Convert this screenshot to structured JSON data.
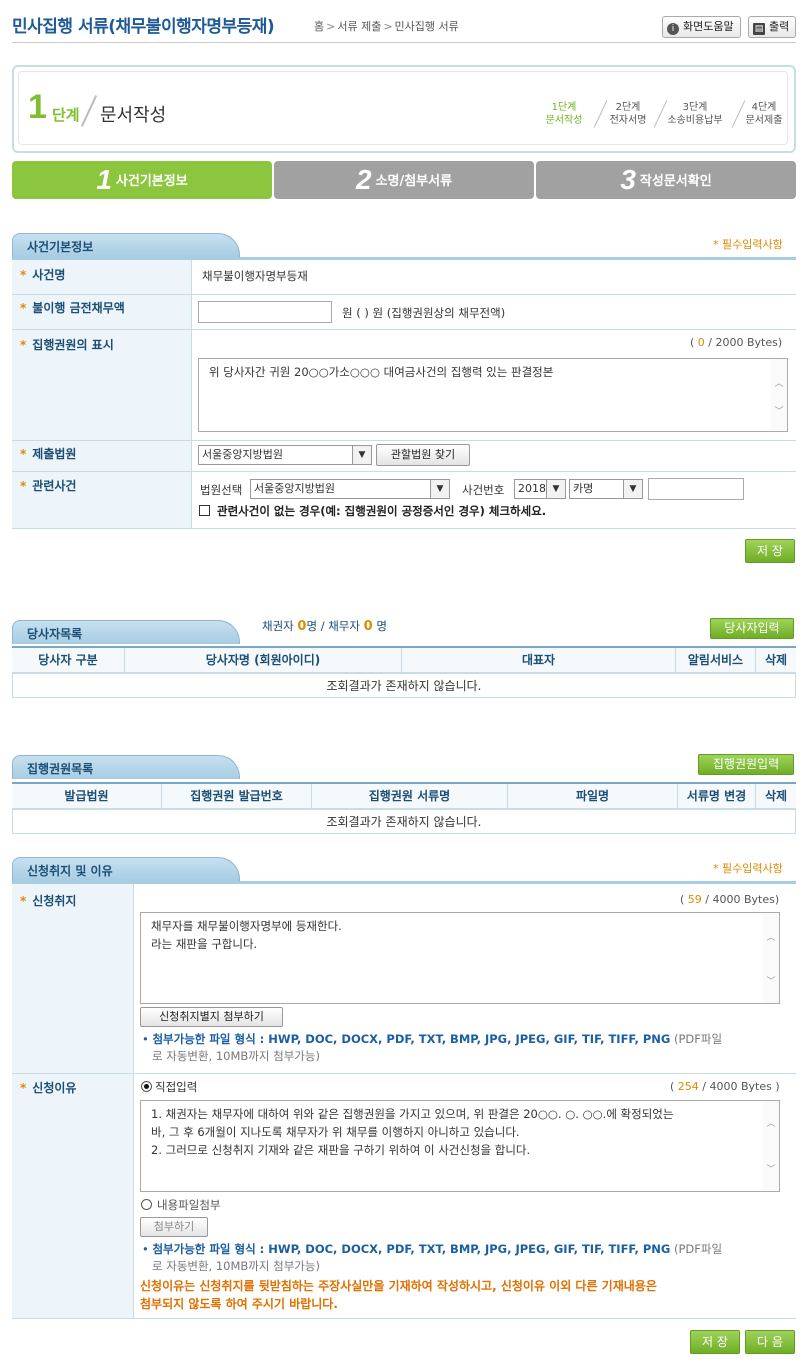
{
  "header": {
    "title": "민사집행 서류(채무불이행자명부등재)",
    "breadcrumb": [
      "홈",
      "서류 제출",
      "민사집행 서류"
    ],
    "help_label": "화면도움말",
    "print_label": "출력"
  },
  "stepbox": {
    "current_num": "1",
    "current_label": "단계",
    "current_name": "문서작성",
    "steps": [
      {
        "num": "1단계",
        "name": "문서작성"
      },
      {
        "num": "2단계",
        "name": "전자서명"
      },
      {
        "num": "3단계",
        "name": "소송비용납부"
      },
      {
        "num": "4단계",
        "name": "문서제출"
      }
    ]
  },
  "tabs": [
    {
      "num": "1",
      "label": "사건기본정보"
    },
    {
      "num": "2",
      "label": "소명/첨부서류"
    },
    {
      "num": "3",
      "label": "작성문서확인"
    }
  ],
  "basic": {
    "title": "사건기본정보",
    "required_note": "* 필수입력사항",
    "case_name_label": "사건명",
    "case_name_value": "채무불이행자명부등재",
    "amount_label": "불이행 금전채무액",
    "amount_unit": "원",
    "amount_note": "원 ( ) 원 (집행권원상의 채무전액)",
    "title_label": "집행권원의 표시",
    "title_count_open": "(",
    "title_count": "0",
    "title_count_total": "/ 2000 Bytes)",
    "title_text": "위 당사자간 귀원 20○○가소○○○ 대여금사건의 집행력 있는 판결정본",
    "court_label": "제출법원",
    "court_value": "서울중앙지방법원",
    "court_button": "관할법원 찾기",
    "related_label": "관련사건",
    "related_court_label": "법원선택",
    "related_court_value": "서울중앙지방법원",
    "related_no_label": "사건번호",
    "related_year": "2018",
    "related_type": "카명",
    "related_check_label": "관련사건이 없는 경우(예: 집행권원이 공정증서인 경우) 체크하세요.",
    "save_label": "저 장"
  },
  "parties": {
    "title": "당사자목록",
    "creditor_label": "채권자",
    "creditor_count": "0",
    "debtor_label": "명 / 채무자",
    "debtor_count": "0",
    "unit": "명",
    "add_button": "당사자입력",
    "columns": [
      "당사자 구분",
      "당사자명 (회원아이디)",
      "대표자",
      "알림서비스",
      "삭제"
    ],
    "empty": "조회결과가 존재하지 않습니다."
  },
  "titles": {
    "title": "집행권원목록",
    "add_button": "집행권원입력",
    "columns": [
      "발급법원",
      "집행권원 발급번호",
      "집행권원 서류명",
      "파일명",
      "서류명 변경",
      "삭제"
    ],
    "empty": "조회결과가 존재하지 않습니다."
  },
  "request": {
    "title": "신청취지 및 이유",
    "required_note": "* 필수입력사항",
    "purpose_label": "신청취지",
    "purpose_count": "59",
    "purpose_count_total": "/ 4000 Bytes)",
    "purpose_lines": [
      "채무자를 채무불이행자명부에 등재한다.",
      "라는 재판을 구합니다."
    ],
    "purpose_attach_button": "신청취지별지 첨부하기",
    "file_note_main": "첨부가능한 파일 형식 : HWP, DOC, DOCX, PDF, TXT, BMP, JPG, JPEG, GIF, TIF, TIFF, PNG",
    "file_note_sub1": "(PDF파일",
    "file_note_sub2": "로 자동변환, 10MB까지 첨부가능)",
    "reason_label": "신청이유",
    "direct_input_label": "직접입력",
    "reason_count": "254",
    "reason_count_total": "/ 4000 Bytes )",
    "reason_lines": [
      "1. 채권자는 채무자에 대하여 위와 같은 집행권원을 가지고 있으며, 위 판결은 20○○. ○. ○○.에 확정되었는",
      "바, 그 후 6개월이 지나도록 채무자가 위 채무를 이행하지 아니하고 있습니다.",
      "2. 그러므로 신청취지 기재와 같은 재판을 구하기 위하여 이 사건신청을 합니다."
    ],
    "file_attach_label": "내용파일첨부",
    "attach_button": "첨부하기",
    "warning_line1": "신청이유는 신청취지를 뒷받침하는 주장사실만을 기재하여 작성하시고, 신청이유 이외 다른 기재내용은",
    "warning_line2": "첨부되지 않도록 하여 주시기 바랍니다."
  },
  "footer": {
    "save_label": "저 장",
    "next_label": "다 음"
  }
}
